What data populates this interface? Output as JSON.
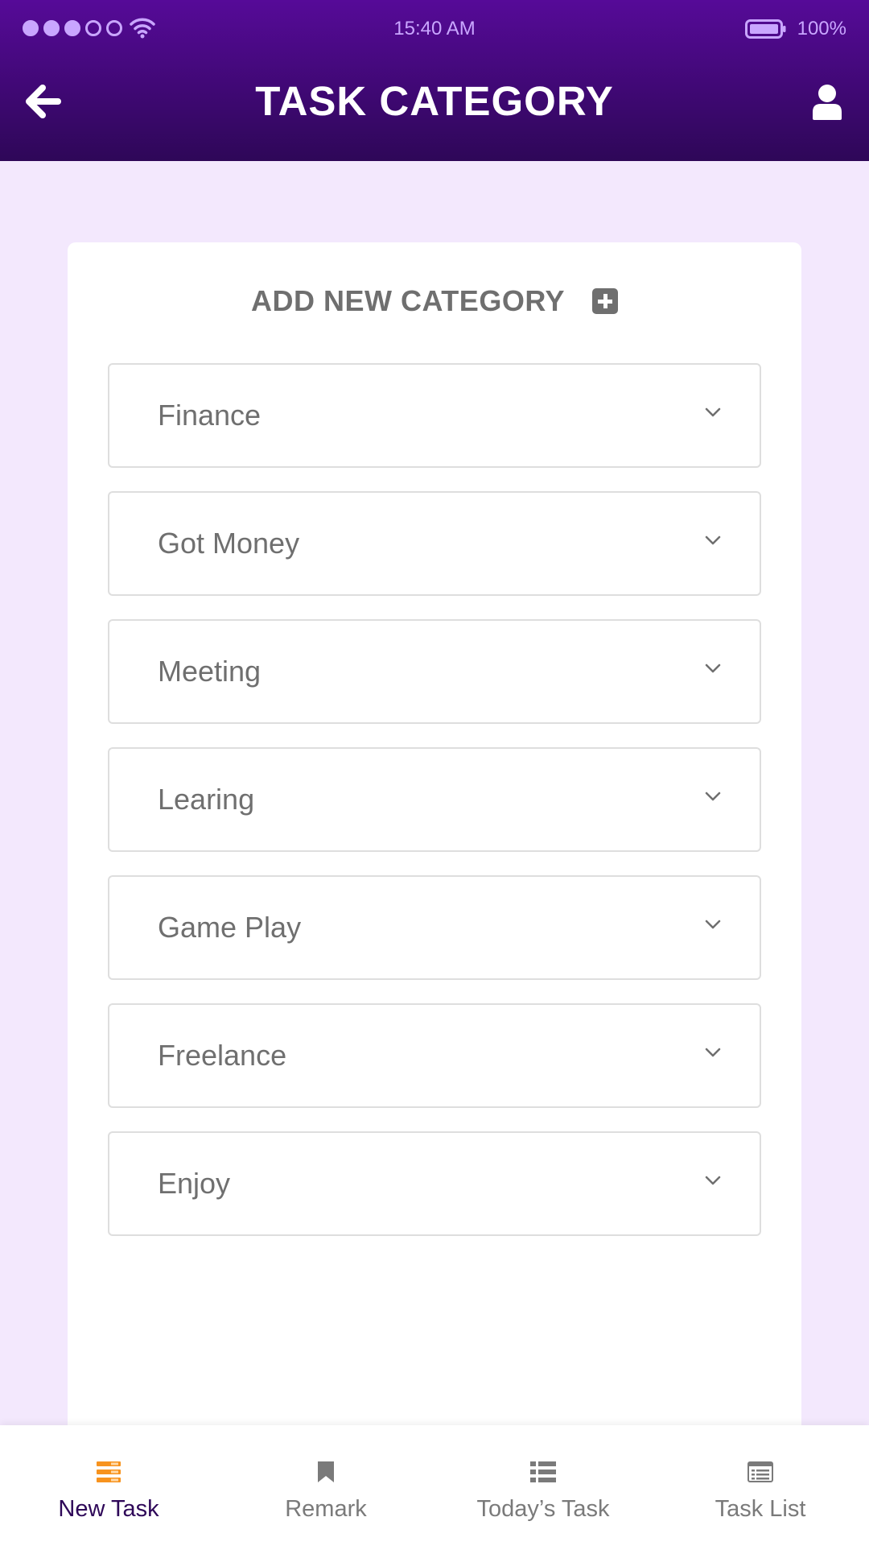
{
  "status_bar": {
    "time": "15:40 AM",
    "battery": "100%"
  },
  "header": {
    "title": "TASK CATEGORY"
  },
  "card": {
    "add_label": "ADD NEW CATEGORY",
    "categories": [
      {
        "label": "Finance"
      },
      {
        "label": "Got Money"
      },
      {
        "label": "Meeting"
      },
      {
        "label": "Learing"
      },
      {
        "label": "Game Play"
      },
      {
        "label": "Freelance"
      },
      {
        "label": "Enjoy"
      }
    ]
  },
  "bottom_nav": {
    "items": [
      {
        "label": "New Task",
        "icon": "new-task-icon",
        "active": true
      },
      {
        "label": "Remark",
        "icon": "bookmark-icon",
        "active": false
      },
      {
        "label": "Today’s Task",
        "icon": "list-icon",
        "active": false
      },
      {
        "label": "Task List",
        "icon": "task-list-icon",
        "active": false
      }
    ]
  },
  "colors": {
    "header_top": "#560a98",
    "header_bottom": "#2e0758",
    "background": "#f3e8fd",
    "accent_orange": "#f7931e",
    "text_gray": "#6f6f6f"
  }
}
